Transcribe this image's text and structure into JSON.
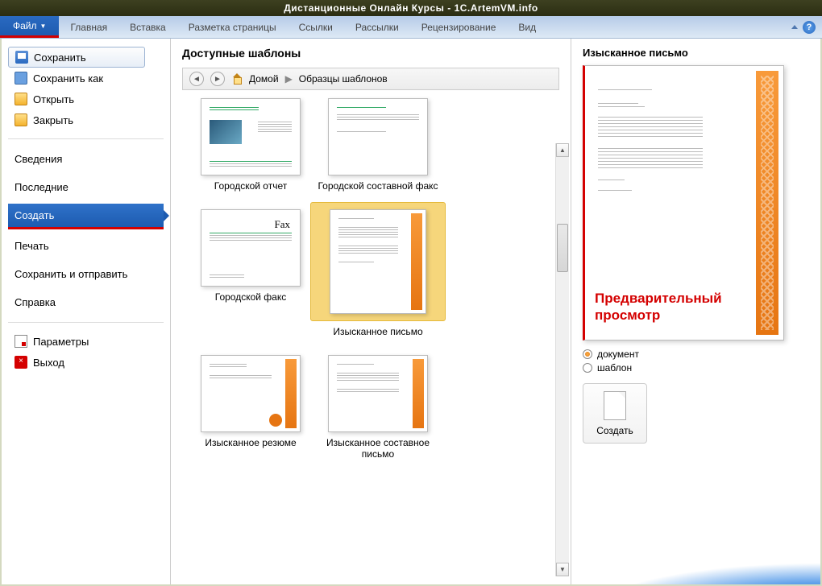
{
  "titlebar": "Дистанционные Онлайн Курсы - 1C.ArtemVM.info",
  "ribbon": {
    "file": "Файл",
    "tabs": [
      "Главная",
      "Вставка",
      "Разметка страницы",
      "Ссылки",
      "Рассылки",
      "Рецензирование",
      "Вид"
    ]
  },
  "sidebar": {
    "save": "Сохранить",
    "save_as": "Сохранить как",
    "open": "Открыть",
    "close": "Закрыть",
    "info": "Сведения",
    "recent": "Последние",
    "create": "Создать",
    "print": "Печать",
    "save_send": "Сохранить и отправить",
    "help": "Справка",
    "options": "Параметры",
    "exit": "Выход"
  },
  "middle": {
    "heading": "Доступные шаблоны",
    "home": "Домой",
    "crumb": "Образцы шаблонов",
    "items": [
      "Городской отчет",
      "Городской составной факс",
      "",
      "Городской факс",
      "Изысканное письмо",
      "",
      "Изысканное резюме",
      "Изысканное составное письмо",
      ""
    ]
  },
  "preview": {
    "title": "Изысканное письмо",
    "annotation": "Предварительный просмотр",
    "radio_doc": "документ",
    "radio_tmpl": "шаблон",
    "create_btn": "Создать"
  },
  "fax_label": "Fax"
}
